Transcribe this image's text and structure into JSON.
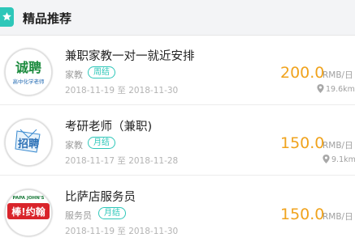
{
  "section": {
    "title": "精品推荐",
    "icon": "star-icon"
  },
  "accent": "#2ec7b9",
  "salary_color": "#f0a31d",
  "listings": [
    {
      "logo": {
        "main": "诚聘",
        "sub": "高中化学老师"
      },
      "title": "兼职家教一对一就近安排",
      "category": "家教",
      "settle": "周结",
      "dates": "2018-11-19 至 2018-11-30",
      "salary": "200.0",
      "unit": "RMB/日",
      "distance": "19.6km"
    },
    {
      "logo": {
        "main": "招聘"
      },
      "title": "考研老师（兼职)",
      "category": "家教",
      "settle": "月结",
      "dates": "2018-11-17 至 2018-11-28",
      "salary": "150.0",
      "unit": "RMB/日",
      "distance": "9.1km"
    },
    {
      "logo": {
        "main": "棒!约翰",
        "top": "PAPA JOHN'S"
      },
      "title": "比萨店服务员",
      "category": "服务员",
      "settle": "月结",
      "dates": "2018-11-19 至 2018-11-30",
      "salary": "150.0",
      "unit": "RMB/日"
    }
  ]
}
